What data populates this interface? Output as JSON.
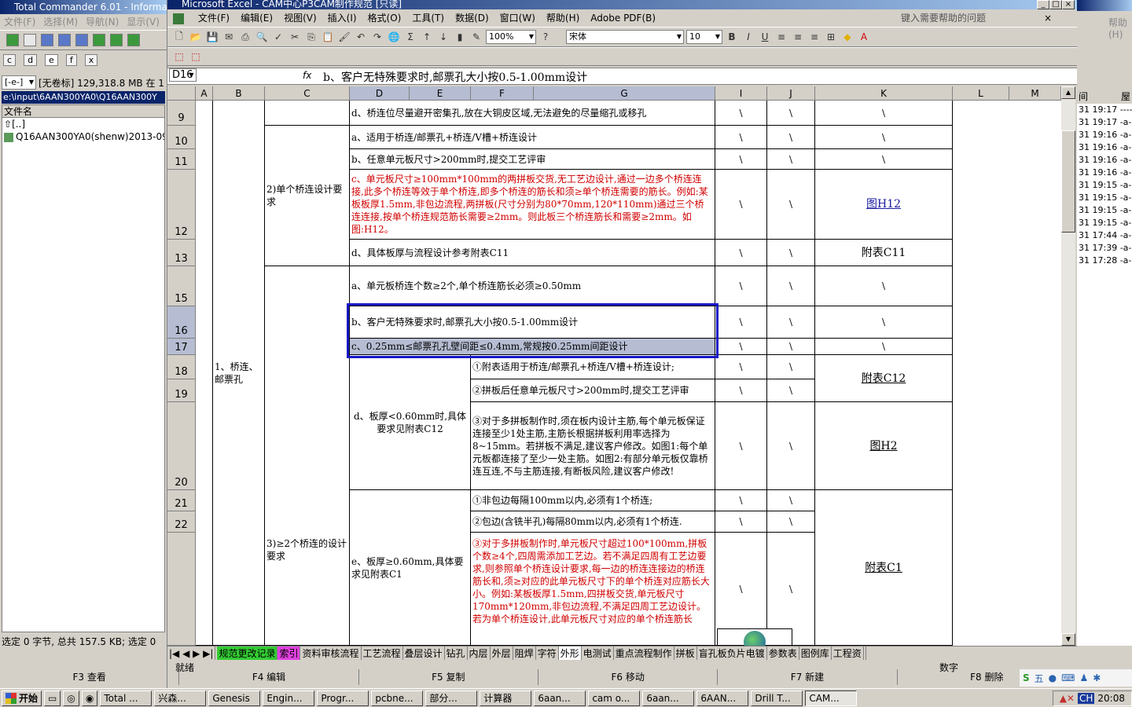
{
  "tc": {
    "title": "Total Commander 6.01 - Informat",
    "menu": [
      "文件(F)",
      "选择(M)",
      "导航(N)",
      "显示(V)"
    ],
    "drives": [
      "c",
      "d",
      "e",
      "f",
      "x"
    ],
    "drive_sel": "[-e-]",
    "drive_info": "[无卷标] 129,318.8 MB 在 1",
    "path": "e:\\input\\6AAN300YA0\\Q16AAN300Y",
    "col_header": "文件名",
    "files": [
      "[..]",
      "Q16AAN300YA0(shenw)2013-09-0"
    ],
    "status": "选定 0 字节, 总共 157.5 KB; 选定 0"
  },
  "fkeys": [
    "F3 查看",
    "F4 编辑",
    "F5 复制",
    "F6 移动",
    "F7 新建",
    "F8 删除"
  ],
  "xl": {
    "title": "Microsoft Excel - CAM中心P3CAM制作规范 [只读]",
    "menu": [
      "文件(F)",
      "编辑(E)",
      "视图(V)",
      "插入(I)",
      "格式(O)",
      "工具(T)",
      "数据(D)",
      "窗口(W)",
      "帮助(H)",
      "Adobe PDF(B)"
    ],
    "help_placeholder": "键入需要帮助的问题",
    "zoom": "100%",
    "font": "宋体",
    "size": "10",
    "namebox": "D16",
    "fx": "fx",
    "formula": "b、客户无特殊要求时,邮票孔大小按0.5-1.00mm设计",
    "status": "就绪",
    "status_num": "数字"
  },
  "cols": [
    "A",
    "B",
    "C",
    "D",
    "E",
    "F",
    "G",
    "I",
    "J",
    "K",
    "L",
    "M"
  ],
  "rows": [
    "9",
    "10",
    "11",
    "12",
    "13",
    "15",
    "16",
    "17",
    "18",
    "19",
    "20",
    "21",
    "22"
  ],
  "cells": {
    "b": "1、桥连、邮票孔",
    "c2": "2)单个桥连设计要求",
    "c3": "3)≥2个桥连的设计要求",
    "r9": "d、桥连位尽量避开密集孔,放在大铜皮区域,无法避免的尽量缩孔或移孔",
    "r10": "a、适用于桥连/邮票孔+桥连/V槽+桥连设计",
    "r11": "b、任意单元板尺寸>200mm时,提交工艺评审",
    "r12": "c、单元板尺寸≥100mm*100mm的两拼板交货,无工艺边设计,通过一边多个桥连连接,此多个桥连等效于单个桥连,即多个桥连的筋长和须≥单个桥连需要的筋长。例如:某板板厚1.5mm,非包边流程,两拼板(尺寸分别为80*70mm,120*110mm)通过三个桥连连接,按单个桥连规范筋长需要≥2mm。则此板三个桥连筋长和需要≥2mm。如图:H12。",
    "r13": "d、具体板厚与流程设计参考附表C11",
    "r15": "a、单元板桥连个数≥2个,单个桥连筋长必须≥0.50mm",
    "r16": "b、客户无特殊要求时,邮票孔大小按0.5-1.00mm设计",
    "r17": "c、0.25mm≤邮票孔孔壁间距≤0.4mm,常规按0.25mm间距设计",
    "d_thin": "d、板厚<0.60mm时,具体要求见附表C12",
    "r18": "①附表适用于桥连/邮票孔+桥连/V槽+桥连设计;",
    "r19": "②拼板后任意单元板尺寸>200mm时,提交工艺评审",
    "r20": "③对于多拼板制作时,须在板内设计主筋,每个单元板保证连接至少1处主筋,主筋长根据拼板利用率选择为8~15mm。若拼板不满足,建议客户修改。如图1:每个单元板都连接了至少一处主筋。如图2:有部分单元板仅靠桥连互连,不与主筋连接,有断板风险,建议客户修改!",
    "e_thick": "e、板厚≥0.60mm,具体要求见附表C1",
    "r21": "①非包边每隔100mm以内,必须有1个桥连;",
    "r22": "②包边(含铣半孔)每隔80mm以内,必须有1个桥连.",
    "r23": "③对于多拼板制作时,单元板尺寸超过100*100mm,拼板个数≥4个,四周需添加工艺边。若不满足四周有工艺边要求,则参照单个桥连设计要求,每一边的桥连连接边的桥连筋长和,须≥对应的此单元板尺寸下的单个桥连对应筋长大小。例如:某板板厚1.5mm,四拼板交货,单元板尺寸170mm*120mm,非包边流程,不满足四周工艺边设计。若为单个桥连设计,此单元板尺寸对应的单个桥连筋长",
    "bs": "\\",
    "k12": "图H12",
    "k13": "附表C11",
    "kc12": "附表C12",
    "kh2": "图H2",
    "kc1": "附表C1"
  },
  "tabs": [
    "规范更改记录",
    "索引",
    "资料审核流程",
    "工艺流程",
    "叠层设计",
    "钻孔",
    "内层",
    "外层",
    "阻焊",
    "字符",
    "外形",
    "电测试",
    "重点流程制作",
    "拼板",
    "盲孔板负片电镀",
    "参数表",
    "图例库",
    "工程资"
  ],
  "rp": {
    "help": "帮助(H)",
    "list": [
      "31 19:17 ----",
      "31 19:17 -a-",
      "31 19:16 -a-",
      "31 19:16 -a-",
      "31 19:16 -a-",
      "31 19:16 -a-",
      "31 19:15 -a-",
      "31 19:15 -a-",
      "31 19:15 -a-",
      "31 19:15 -a-",
      "31 17:44 -a-",
      "31 17:39 -a-",
      "31 17:28 -a-"
    ],
    "hdr": "间",
    "hdr2": "屋"
  },
  "task": {
    "start": "开始",
    "items": [
      "Total ...",
      "兴森...",
      "Genesis",
      "Engin...",
      "Progr...",
      "pcbne...",
      "部分...",
      "计算器",
      "6aan...",
      "cam o...",
      "6aan...",
      "6AAN...",
      "Drill T...",
      "CAM..."
    ],
    "clock": "20:08",
    "ime": "五",
    "lang": "CH"
  },
  "colors": {
    "select": "#1717c8",
    "red": "#d00000",
    "title": "#0a246a"
  }
}
